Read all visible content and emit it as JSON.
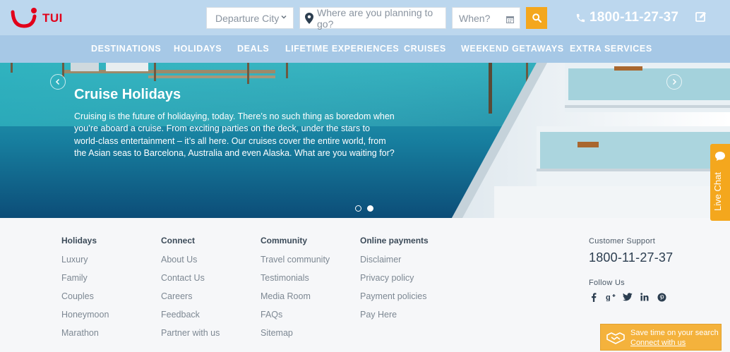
{
  "brand": {
    "name": "TUI",
    "color": "#e2001a"
  },
  "search": {
    "departure_placeholder": "Departure City",
    "where_placeholder": "Where are you planning to go?",
    "when_placeholder": "When?",
    "accent": "#f4a71d"
  },
  "header": {
    "phone": "1800-11-27-37"
  },
  "nav": {
    "items": [
      "DESTINATIONS",
      "HOLIDAYS",
      "DEALS",
      "LIFETIME EXPERIENCES",
      "CRUISES",
      "WEEKEND GETAWAYS",
      "EXTRA SERVICES"
    ]
  },
  "hero": {
    "title": "Cruise Holidays",
    "text": "Cruising is the future of holidaying, today. There’s no such thing as boredom when you’re aboard a cruise. From exciting parties on the deck, under the stars to world-class entertainment – it’s all here. Our cruises cover the entire world, from the Asian seas to Barcelona, Australia and even Alaska. What are you waiting for?",
    "slides_count": 2,
    "active_slide": 2
  },
  "live_chat": {
    "label": "Live Chat"
  },
  "footer": {
    "columns": [
      {
        "title": "Holidays",
        "links": [
          "Luxury",
          "Family",
          "Couples",
          "Honeymoon",
          "Marathon"
        ]
      },
      {
        "title": "Connect",
        "links": [
          "About Us",
          "Contact Us",
          "Careers",
          "Feedback",
          "Partner with us"
        ]
      },
      {
        "title": "Community",
        "links": [
          "Travel community",
          "Testimonials",
          "Media Room",
          "FAQs",
          "Sitemap"
        ]
      },
      {
        "title": "Online payments",
        "links": [
          "Disclaimer",
          "Privacy policy",
          "Payment policies",
          "Pay Here"
        ]
      }
    ],
    "support": {
      "label": "Customer Support",
      "phone": "1800-11-27-37",
      "follow_label": "Follow Us",
      "socials": [
        "facebook-icon",
        "google-plus-icon",
        "twitter-icon",
        "linkedin-icon",
        "pinterest-icon"
      ]
    }
  },
  "connect_banner": {
    "line1": "Save time on your search",
    "link": "Connect with us"
  }
}
